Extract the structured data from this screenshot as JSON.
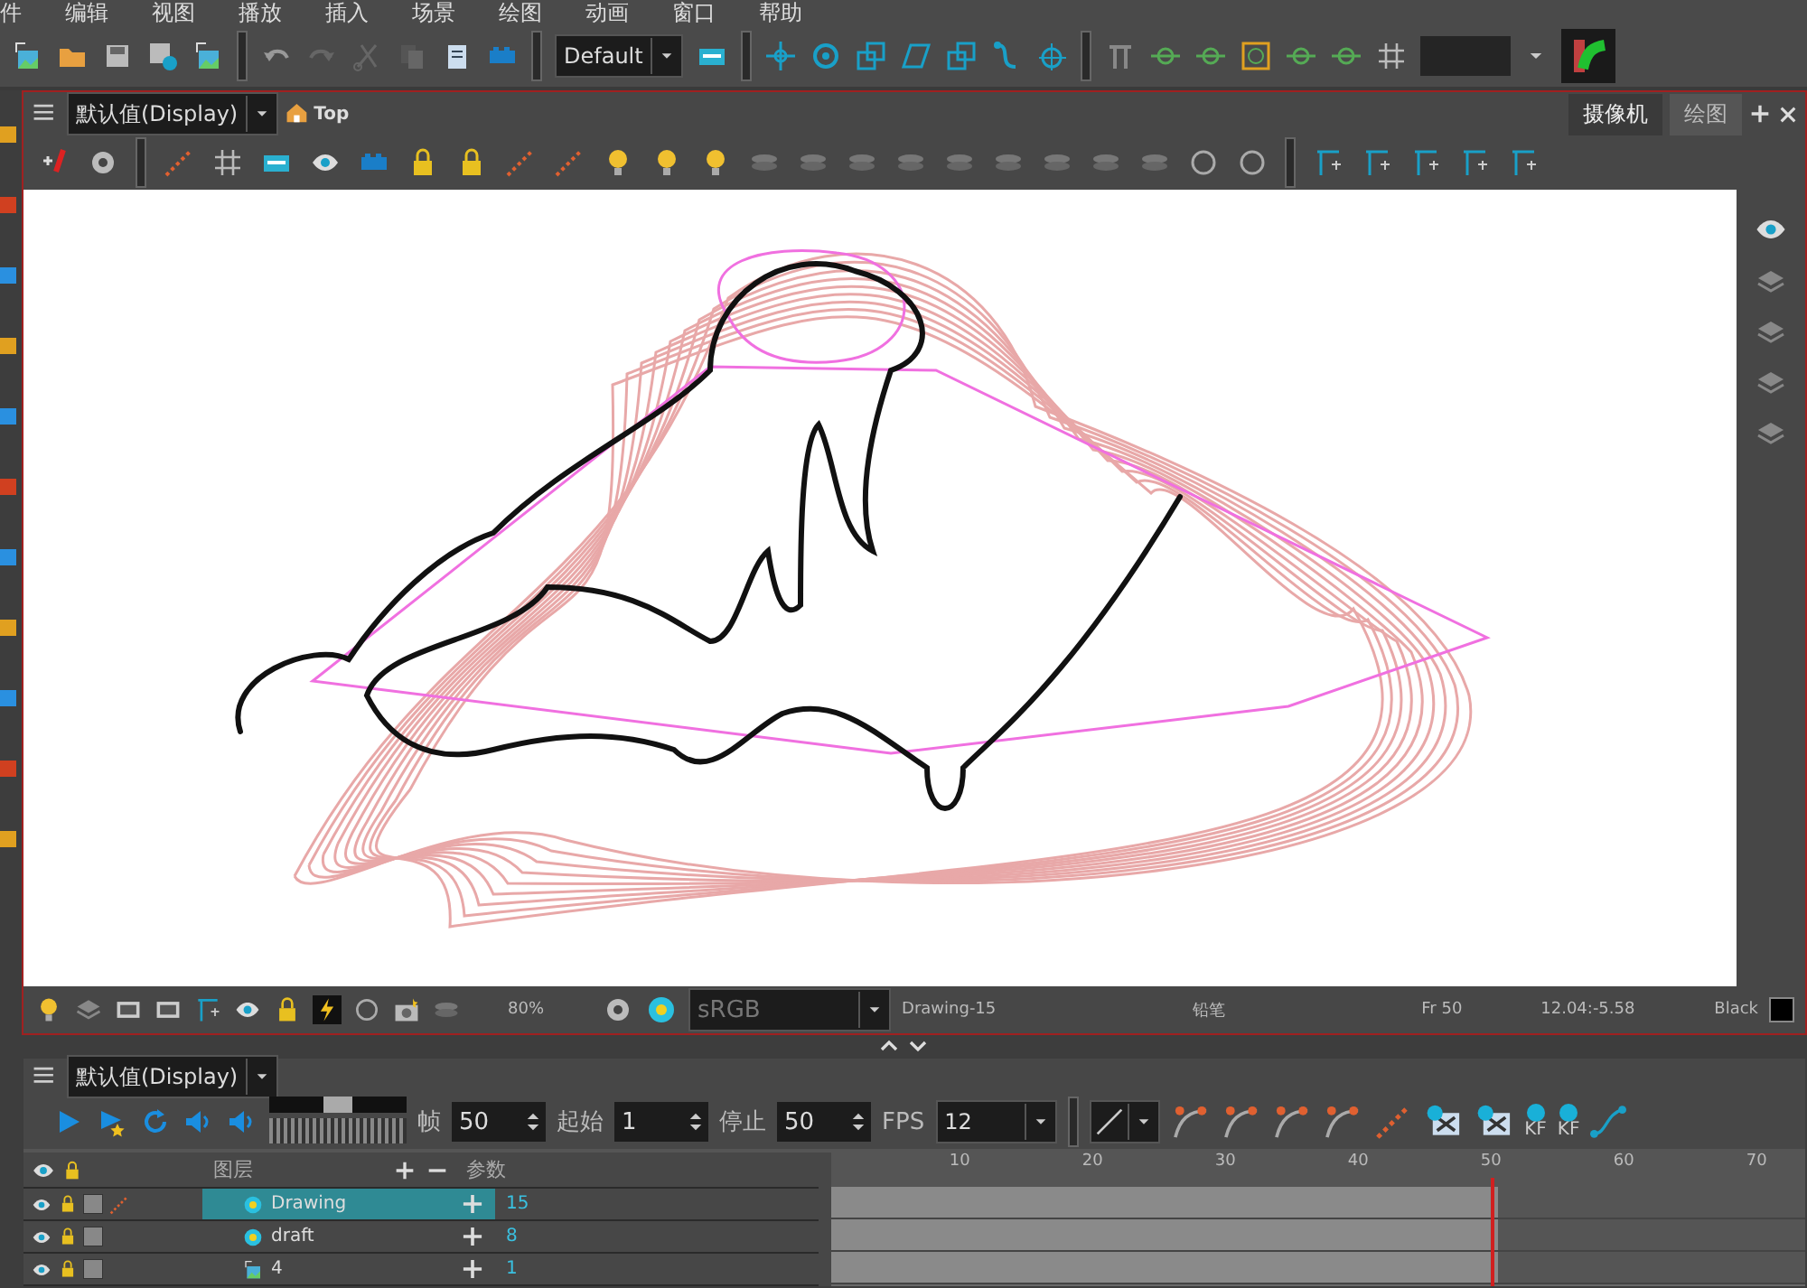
{
  "menu": [
    "件",
    "编辑",
    "视图",
    "播放",
    "插入",
    "场景",
    "绘图",
    "动画",
    "窗口",
    "帮助"
  ],
  "toolbar": {
    "preset": "Default"
  },
  "camera_view": {
    "display": "默认值(Display)",
    "breadcrumb": "Top",
    "tabs": [
      {
        "label": "摄像机",
        "selected": true
      },
      {
        "label": "绘图",
        "selected": false
      }
    ],
    "status": {
      "zoom": "80%",
      "color_space": "sRGB",
      "drawing": "Drawing-15",
      "tool": "铅笔",
      "frame": "Fr 50",
      "coordinates": "12.04:-5.58",
      "color_name": "Black",
      "color": "#000000"
    }
  },
  "timeline": {
    "display": "默认值(Display)",
    "speed_slider": {
      "level": 0.5
    },
    "fields": [
      {
        "label": "帧",
        "value": "50"
      },
      {
        "label": "起始",
        "value": "1"
      },
      {
        "label": "停止",
        "value": "50"
      }
    ],
    "fps": {
      "label": "FPS",
      "value": "12"
    },
    "keyframe_buttons": [
      "KF",
      "KF"
    ],
    "columns": [
      "图层",
      "参数"
    ],
    "layers": [
      {
        "name": "Drawing",
        "kind": "drawing",
        "value": "15",
        "selected": true
      },
      {
        "name": "draft",
        "kind": "drawing",
        "value": "8",
        "selected": false
      },
      {
        "name": "4",
        "kind": "image",
        "value": "1",
        "selected": false
      }
    ],
    "ruler": [
      "10",
      "20",
      "30",
      "40",
      "50",
      "60",
      "70"
    ]
  }
}
